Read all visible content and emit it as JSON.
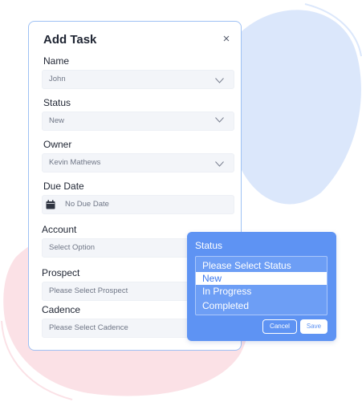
{
  "dialog": {
    "title": "Add Task",
    "fields": {
      "name": {
        "label": "Name",
        "value": "John"
      },
      "status": {
        "label": "Status",
        "value": "New"
      },
      "owner": {
        "label": "Owner",
        "value": "Kevin Mathews"
      },
      "due_date": {
        "label": "Due Date",
        "value": "No Due Date"
      },
      "account": {
        "label": "Account",
        "value": "Select Option"
      },
      "prospect": {
        "label": "Prospect",
        "value": "Please Select Prospect"
      },
      "cadence": {
        "label": "Cadence",
        "value": "Please Select Cadence"
      }
    }
  },
  "status_popup": {
    "title": "Status",
    "options": [
      "Please Select  Status",
      "New",
      "In Progress",
      "Completed"
    ],
    "selected": "New",
    "cancel_label": "Cancel",
    "save_label": "Save"
  },
  "colors": {
    "accent": "#5e93f3",
    "dialog_border": "#9ec1f4",
    "blob_blue": "#dbe7fb",
    "blob_pink": "#fbe1e6"
  },
  "icons": [
    "close-icon",
    "chevron-down-icon",
    "calendar-icon"
  ]
}
